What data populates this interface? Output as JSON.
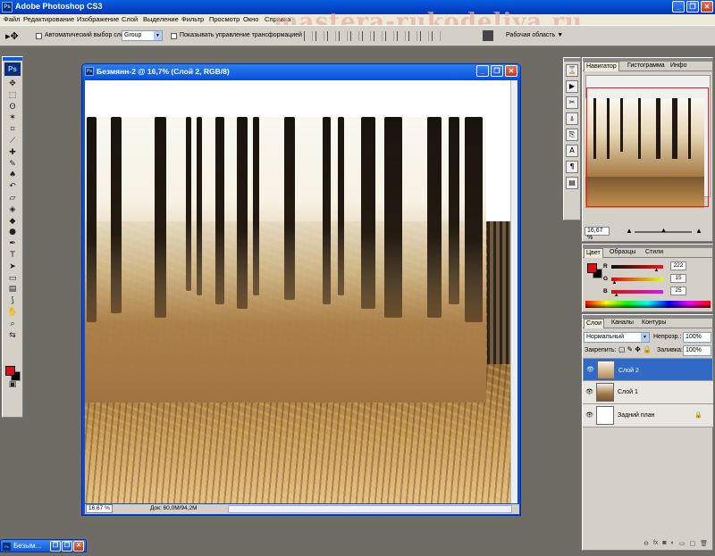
{
  "app": {
    "title": "Adobe Photoshop CS3"
  },
  "window_buttons": {
    "minimize": "_",
    "restore": "❐",
    "close": "✕"
  },
  "menu": [
    "Файл",
    "Редактирование",
    "Изображение",
    "Слой",
    "Выделение",
    "Фильтр",
    "Просмотр",
    "Окно",
    "Справка"
  ],
  "watermark": "mastera-rukodeliya.ru",
  "options": {
    "auto_select_label": "Автоматический выбор слоя",
    "auto_select_value": "Group",
    "show_transform_label": "Показывать управление трансформацией",
    "workspace_label": "Рабочая область ▼"
  },
  "tools_palette": {
    "logo": "Ps"
  },
  "document": {
    "title": "Безмянн-2 @ 16,7% (Слой 2, RGB/8)",
    "zoom": "16,67 %",
    "doc_size": "Док: 60,0M/94,2M"
  },
  "navigator": {
    "tabs": [
      "Навигатор",
      "Гистограмма",
      "Инфо"
    ],
    "zoom": "16,67 %"
  },
  "color": {
    "tabs": [
      "Цвет",
      "Образцы",
      "Стили"
    ],
    "channels": [
      {
        "name": "R",
        "value": "222",
        "level": 0.87,
        "gradient": "linear-gradient(90deg, #001010, #ff1010)"
      },
      {
        "name": "G",
        "value": "15",
        "level": 0.06,
        "gradient": "linear-gradient(90deg, #de0010, #deff10)"
      },
      {
        "name": "B",
        "value": "25",
        "level": 0.1,
        "gradient": "linear-gradient(90deg, #de0f00, #de0fff)"
      }
    ],
    "foreground": "#de0f19",
    "background": "#000000"
  },
  "layers": {
    "tabs": [
      "Слои",
      "Каналы",
      "Контуры"
    ],
    "blend_mode": "Нормальный",
    "opacity_label": "Непрозр.:",
    "opacity": "100%",
    "lock_label": "Закрепить:",
    "fill_label": "Заливка:",
    "fill": "100%",
    "items": [
      {
        "name": "Слой 2",
        "selected": true
      },
      {
        "name": "Слой 1",
        "selected": false
      },
      {
        "name": "Задний план",
        "selected": false,
        "locked": true
      }
    ]
  },
  "minimized_doc": {
    "title": "Безым..."
  }
}
